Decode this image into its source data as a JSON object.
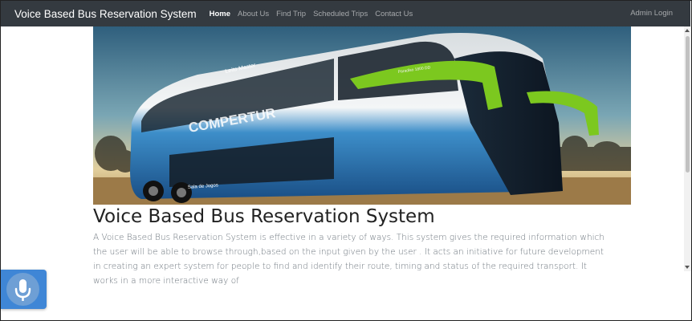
{
  "navbar": {
    "brand": "Voice Based Bus Reservation System",
    "links": [
      {
        "label": "Home",
        "active": true
      },
      {
        "label": "About Us",
        "active": false
      },
      {
        "label": "Find Trip",
        "active": false
      },
      {
        "label": "Scheduled Trips",
        "active": false
      },
      {
        "label": "Contact Us",
        "active": false
      }
    ],
    "admin_label": "Admin Login"
  },
  "hero": {
    "bus_brand": "COMPERTUR",
    "bus_model": "Leito Master",
    "bus_sign": "Sala de Jogos",
    "bus_plate": "Paradiso 1800 DD"
  },
  "main": {
    "title": "Voice Based Bus Reservation System",
    "description": "A Voice Based Bus Reservation System is effective in a variety of ways. This system gives the required information which the user will be able to browse through,based on the input given by the user . It acts an initiative for future development in creating an expert system for people to find and identify their route, timing and status of the required transport. It works in a more interactive way of"
  },
  "voice_button": {
    "icon": "microphone-icon"
  },
  "colors": {
    "navbar": "#343a40",
    "accent": "#3f86d6",
    "bus_green": "#7cc81f",
    "bus_blue": "#1f6fb3"
  }
}
